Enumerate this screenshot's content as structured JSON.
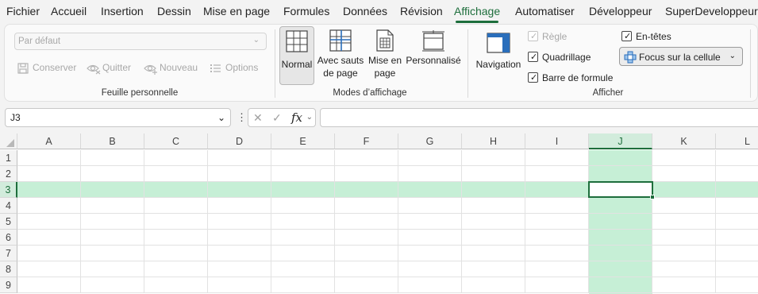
{
  "menu_tabs": [
    "Fichier",
    "Accueil",
    "Insertion",
    "Dessin",
    "Mise en page",
    "Formules",
    "Données",
    "Révision",
    "Affichage",
    "Automatiser",
    "Développeur",
    "SuperDeveloppeur"
  ],
  "active_tab": "Affichage",
  "accent_color": "#1e6e3c",
  "highlight_color": "#c6efd6",
  "sheet_view": {
    "dropdown_value": "Par défaut",
    "keep_label": "Conserver",
    "exit_label": "Quitter",
    "new_label": "Nouveau",
    "options_label": "Options",
    "group_label": "Feuille personnelle"
  },
  "workbook_views": {
    "normal_label": "Normal",
    "page_break_label_1": "Avec sauts",
    "page_break_label_2": "de page",
    "page_layout_label_1": "Mise en",
    "page_layout_label_2": "page",
    "custom_label": "Personnalisé",
    "group_label": "Modes d’affichage"
  },
  "show": {
    "navigation_label": "Navigation",
    "ruler_label": "Règle",
    "gridlines_label": "Quadrillage",
    "formula_bar_label": "Barre de formule",
    "headings_label": "En-têtes",
    "focus_cell_label": "Focus sur la cellule",
    "group_label": "Afficher",
    "ruler_checked": true,
    "gridlines_checked": true,
    "formula_bar_checked": true,
    "headings_checked": true
  },
  "formula_bar": {
    "name_box_value": "J3",
    "fx_label": "fx",
    "formula_value": ""
  },
  "grid": {
    "columns": [
      "A",
      "B",
      "C",
      "D",
      "E",
      "F",
      "G",
      "H",
      "I",
      "J",
      "K",
      "L"
    ],
    "rows": [
      "1",
      "2",
      "3",
      "4",
      "5",
      "6",
      "7",
      "8",
      "9"
    ],
    "selected_column": "J",
    "selected_row": "3"
  }
}
